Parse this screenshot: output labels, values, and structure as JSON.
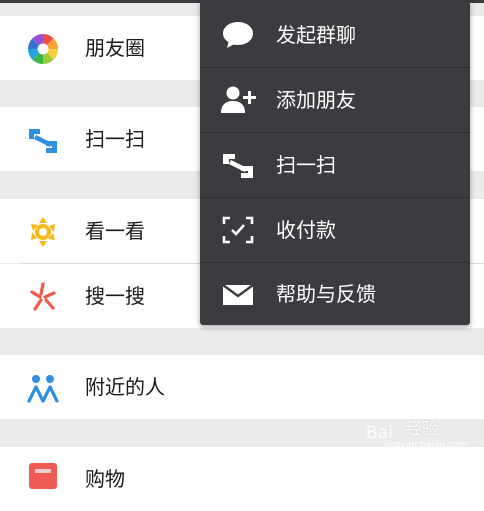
{
  "discover_list": {
    "items": [
      {
        "label": "朋友圈",
        "icon": "moments-icon"
      },
      {
        "label": "扫一扫",
        "icon": "scan-icon"
      },
      {
        "label": "看一看",
        "icon": "top-stories-icon"
      },
      {
        "label": "搜一搜",
        "icon": "search-icon"
      },
      {
        "label": "附近的人",
        "icon": "people-nearby-icon"
      },
      {
        "label": "购物",
        "icon": "shopping-icon"
      }
    ]
  },
  "popup_menu": {
    "items": [
      {
        "label": "发起群聊",
        "icon": "chat-bubble-icon"
      },
      {
        "label": "添加朋友",
        "icon": "add-friend-icon"
      },
      {
        "label": "扫一扫",
        "icon": "scan-icon"
      },
      {
        "label": "收付款",
        "icon": "payment-scan-icon"
      },
      {
        "label": "帮助与反馈",
        "icon": "mail-icon"
      }
    ]
  },
  "watermark": {
    "brand": "Bai",
    "brand_cn": "经验",
    "url": "jingyan.baidu.com"
  },
  "colors": {
    "background": "#ebebeb",
    "menu_background": "#3b3c3f",
    "text": "#1a1a1a",
    "menu_text": "#ffffff"
  }
}
